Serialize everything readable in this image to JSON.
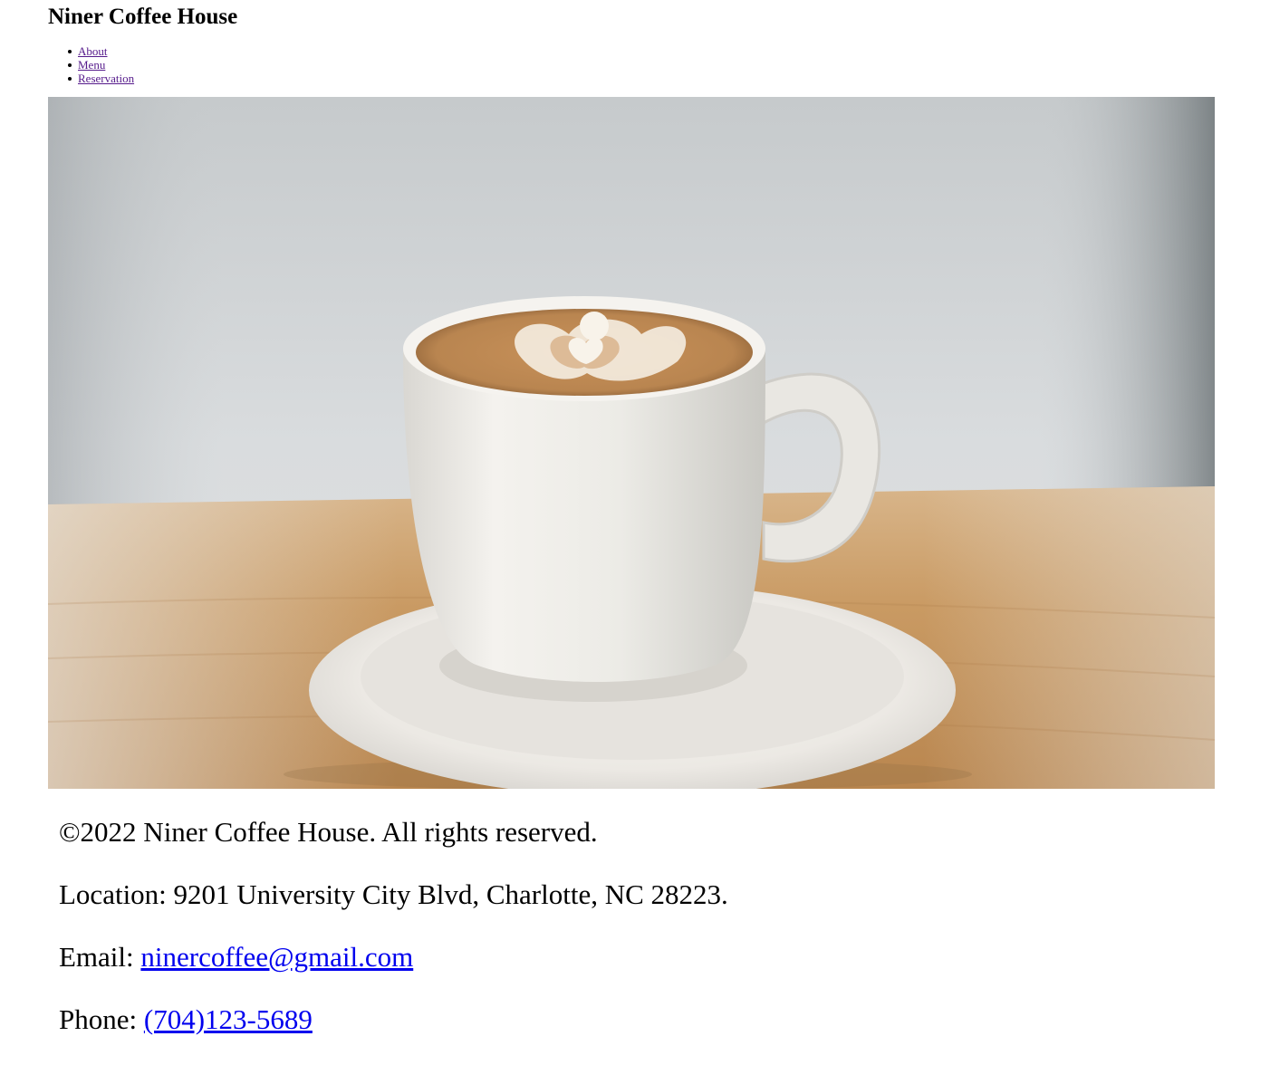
{
  "header": {
    "title": "Niner Coffee House"
  },
  "nav": {
    "items": [
      {
        "label": "About"
      },
      {
        "label": "Menu"
      },
      {
        "label": "Reservation"
      }
    ]
  },
  "hero": {
    "icon": "latte-cup-photo",
    "colors": {
      "background": "#d2d6d8",
      "table": "#c99a63",
      "cup": "#f2efe9",
      "coffee": "#c48c55",
      "foam": "#f8f3ea"
    }
  },
  "footer": {
    "copyright": "©2022 Niner Coffee House. All rights reserved.",
    "location": "Location: 9201 University City Blvd, Charlotte, NC 28223.",
    "email_label": "Email: ",
    "email": "ninercoffee@gmail.com",
    "phone_label": "Phone: ",
    "phone": "(704)123-5689",
    "link_color": "#0000ee"
  }
}
